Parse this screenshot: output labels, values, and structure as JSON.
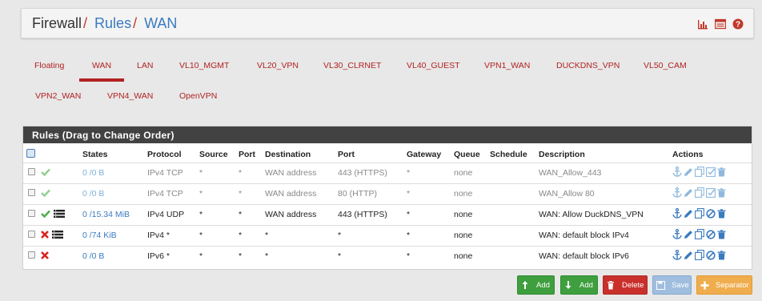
{
  "breadcrumb": {
    "root": "Firewall",
    "sep1": "/",
    "rules": "Rules",
    "sep2": "/",
    "current": "WAN"
  },
  "header_icons": [
    "chart-icon",
    "list-icon",
    "help-icon"
  ],
  "tabs": [
    [
      "Floating",
      "WAN",
      "LAN",
      "VL10_MGMT",
      "VL20_VPN",
      "VL30_CLRNET",
      "VL40_GUEST",
      "VPN1_WAN",
      "DUCKDNS_VPN",
      "VL50_CAM"
    ],
    [
      "VPN2_WAN",
      "VPN4_WAN",
      "OpenVPN"
    ]
  ],
  "active_tab": "WAN",
  "panel_title": "Rules (Drag to Change Order)",
  "columns": {
    "states": "States",
    "protocol": "Protocol",
    "source": "Source",
    "port": "Port",
    "destination": "Destination",
    "dport": "Port",
    "gateway": "Gateway",
    "queue": "Queue",
    "schedule": "Schedule",
    "description": "Description",
    "actions": "Actions"
  },
  "rules": [
    {
      "disabled": true,
      "action": "pass",
      "log": false,
      "states": "0 /0 B",
      "protocol": "IPv4 TCP",
      "source": "*",
      "port": "*",
      "destination": "WAN address",
      "dport": "443 (HTTPS)",
      "gateway": "*",
      "queue": "none",
      "schedule": "",
      "description": "WAN_Allow_443"
    },
    {
      "disabled": true,
      "action": "pass",
      "log": false,
      "states": "0 /0 B",
      "protocol": "IPv4 TCP",
      "source": "*",
      "port": "*",
      "destination": "WAN address",
      "dport": "80 (HTTP)",
      "gateway": "*",
      "queue": "none",
      "schedule": "",
      "description": "WAN_Allow 80"
    },
    {
      "disabled": false,
      "action": "pass",
      "log": true,
      "states": "0 /15.34 MiB",
      "protocol": "IPv4 UDP",
      "source": "*",
      "port": "*",
      "destination": "WAN address",
      "dport": "443 (HTTPS)",
      "gateway": "*",
      "queue": "none",
      "schedule": "",
      "description": "WAN: Allow DuckDNS_VPN"
    },
    {
      "disabled": false,
      "action": "block",
      "log": true,
      "states": "0 /74 KiB",
      "protocol": "IPv4 *",
      "source": "*",
      "port": "*",
      "destination": "*",
      "dport": "*",
      "gateway": "*",
      "queue": "none",
      "schedule": "",
      "description": "WAN: default block IPv4"
    },
    {
      "disabled": false,
      "action": "block",
      "log": false,
      "states": "0 /0 B",
      "protocol": "IPv6 *",
      "source": "*",
      "port": "*",
      "destination": "*",
      "dport": "*",
      "gateway": "*",
      "queue": "none",
      "schedule": "",
      "description": "WAN: default block IPv6"
    }
  ],
  "buttons": {
    "add_top": "Add",
    "add_bottom": "Add",
    "delete": "Delete",
    "save": "Save",
    "separator": "Separator"
  },
  "colors": {
    "accent_red": "#b22222",
    "link_blue": "#3a7bbf",
    "pass_green": "#4cae4c",
    "block_red": "#d9231d",
    "panel_dark": "#424242"
  }
}
